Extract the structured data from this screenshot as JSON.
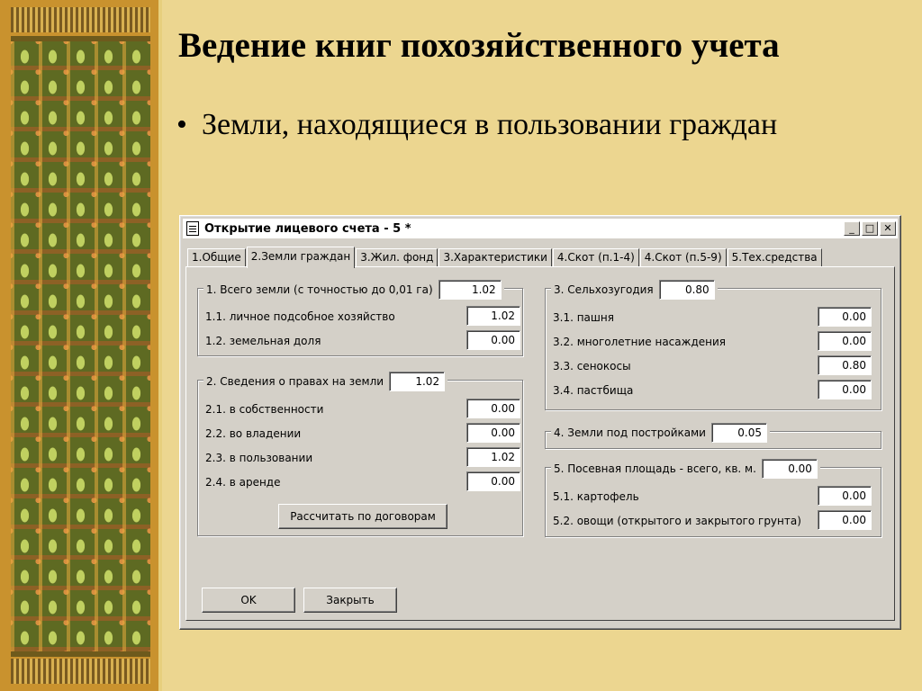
{
  "slide": {
    "title": "Ведение книг похозяйственного учета",
    "bullet": "Земли, находящиеся в пользовании граждан",
    "bullet_marker": "•"
  },
  "window": {
    "title": "Открытие лицевого счета - 5 *",
    "controls": {
      "minimize": "_",
      "maximize": "□",
      "close": "✕"
    }
  },
  "tabs": [
    {
      "label": "1.Общие"
    },
    {
      "label": "2.Земли граждан",
      "active": true
    },
    {
      "label": "3.Жил. фонд"
    },
    {
      "label": "3.Характеристики"
    },
    {
      "label": "4.Скот (п.1-4)"
    },
    {
      "label": "4.Скот (п.5-9)"
    },
    {
      "label": "5.Тех.средства"
    }
  ],
  "group1": {
    "label": "1. Всего земли (с точностью до 0,01 га)",
    "total": "1.02",
    "rows": [
      {
        "label": "1.1. личное подсобное хозяйство",
        "value": "1.02"
      },
      {
        "label": "1.2. земельная доля",
        "value": "0.00"
      }
    ]
  },
  "group2": {
    "label": "2. Сведения о правах на земли",
    "total": "1.02",
    "rows": [
      {
        "label": "2.1. в собственности",
        "value": "0.00"
      },
      {
        "label": "2.2. во владении",
        "value": "0.00"
      },
      {
        "label": "2.3. в пользовании",
        "value": "1.02"
      },
      {
        "label": "2.4. в аренде",
        "value": "0.00"
      }
    ],
    "calc_button": "Рассчитать по договорам"
  },
  "group3": {
    "label": "3. Сельхозугодия",
    "total": "0.80",
    "rows": [
      {
        "label": "3.1. пашня",
        "value": "0.00"
      },
      {
        "label": "3.2. многолетние насаждения",
        "value": "0.00"
      },
      {
        "label": "3.3. сенокосы",
        "value": "0.80"
      },
      {
        "label": "3.4. пастбища",
        "value": "0.00"
      }
    ]
  },
  "group4": {
    "label": "4. Земли под постройками",
    "total": "0.05"
  },
  "group5": {
    "label": "5. Посевная площадь - всего, кв. м.",
    "total": "0.00",
    "rows": [
      {
        "label": "5.1. картофель",
        "value": "0.00"
      },
      {
        "label": "5.2. овощи (открытого и закрытого грунта)",
        "value": "0.00"
      }
    ]
  },
  "buttons": {
    "ok": "OK",
    "close": "Закрыть"
  }
}
